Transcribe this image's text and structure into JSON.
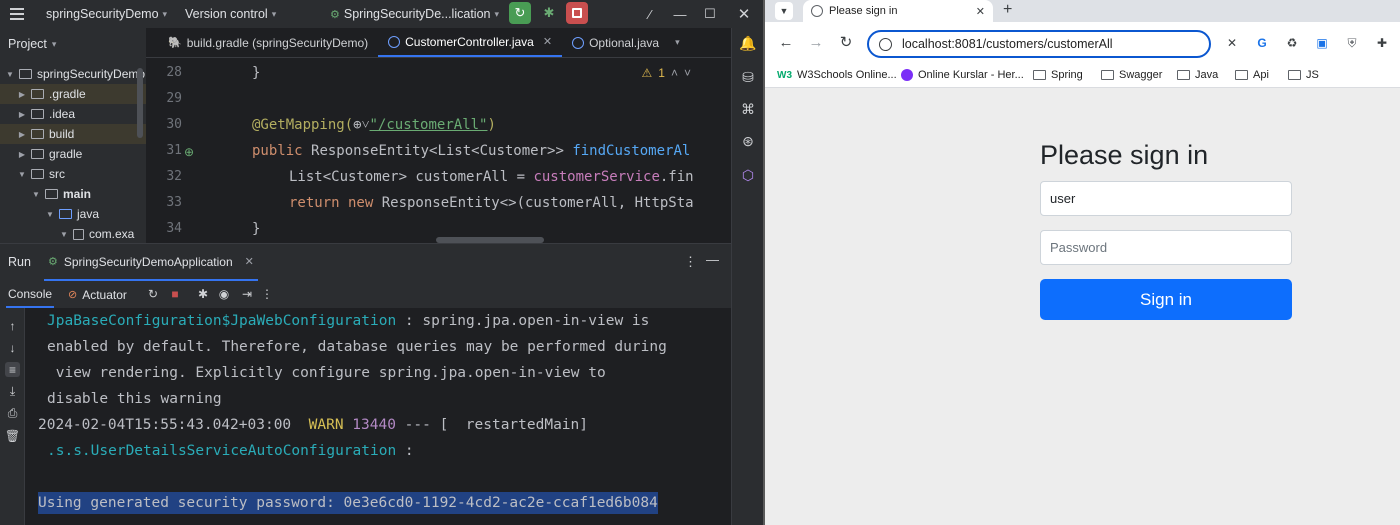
{
  "ide": {
    "title_bar": {
      "project_name": "springSecurityDemo",
      "vcs_label": "Version control",
      "run_config": "SpringSecurityDe...lication"
    },
    "project_panel": {
      "title": "Project",
      "items": [
        {
          "label": "springSecurityDemo",
          "expanded": true
        },
        {
          "label": ".gradle"
        },
        {
          "label": ".idea"
        },
        {
          "label": "build"
        },
        {
          "label": "gradle"
        },
        {
          "label": "src",
          "expanded": true
        },
        {
          "label": "main",
          "expanded": true
        },
        {
          "label": "java",
          "expanded": true
        },
        {
          "label": "com.exa"
        }
      ]
    },
    "editor": {
      "tabs": [
        {
          "label": "build.gradle (springSecurityDemo)"
        },
        {
          "label": "CustomerController.java",
          "active": true
        },
        {
          "label": "Optional.java"
        }
      ],
      "warning_count": "1",
      "line_numbers": [
        "28",
        "29",
        "30",
        "31",
        "32",
        "33",
        "34"
      ],
      "code": {
        "l28": "}",
        "l30_ann": "@GetMapping(",
        "l30_str": "\"/customerAll\"",
        "l30_end": ")",
        "l31_kw": "public ",
        "l31_type": "ResponseEntity<List<Customer>> ",
        "l31_fn": "findCustomerAl",
        "l32_type": "List<Customer> customerAll = ",
        "l32_fld": "customerService",
        "l32_rest": ".fin",
        "l33_kw": "return new ",
        "l33_rest": "ResponseEntity<>(customerAll, HttpSta",
        "l34": "}"
      }
    },
    "run_panel": {
      "label": "Run",
      "tab": "SpringSecurityDemoApplication",
      "console_tab": "Console",
      "actuator_tab": "Actuator"
    },
    "console_lines": {
      "l1_teal": "JpaBaseConfiguration$JpaWebConfiguration",
      "l1_rest": " : spring.jpa.open-in-view is",
      "l2": "enabled by default. Therefore, database queries may be performed during",
      "l3": " view rendering. Explicitly configure spring.jpa.open-in-view to",
      "l4": "disable this warning",
      "l5_time": "2024-02-04T15:55:43.042+03:00  ",
      "l5_warn": "WARN",
      "l5_pid": " 13440",
      "l5_rest": " --- [  restartedMain]",
      "l6_teal": ".s.s.UserDetailsServiceAutoConfiguration",
      "l6_rest": " :",
      "l8": "Using generated security password: 0e3e6cd0-1192-4cd2-ac2e-ccaf1ed6b084"
    }
  },
  "browser": {
    "tab_title": "Please sign in",
    "url": "localhost:8081/customers/customerAll",
    "bookmarks": [
      {
        "label": "W3Schools Online..."
      },
      {
        "label": "Online Kurslar - Her..."
      },
      {
        "label": "Spring"
      },
      {
        "label": "Swagger"
      },
      {
        "label": "Java"
      },
      {
        "label": "Api"
      },
      {
        "label": "JS"
      }
    ],
    "form": {
      "heading": "Please sign in",
      "username_value": "user",
      "password_placeholder": "Password",
      "submit_label": "Sign in"
    }
  },
  "colors": {
    "accent_blue": "#3574f0",
    "signin_button": "#0d6efd",
    "run_button": "#499c54",
    "stop_button": "#c94f4f",
    "selection": "#214283"
  }
}
